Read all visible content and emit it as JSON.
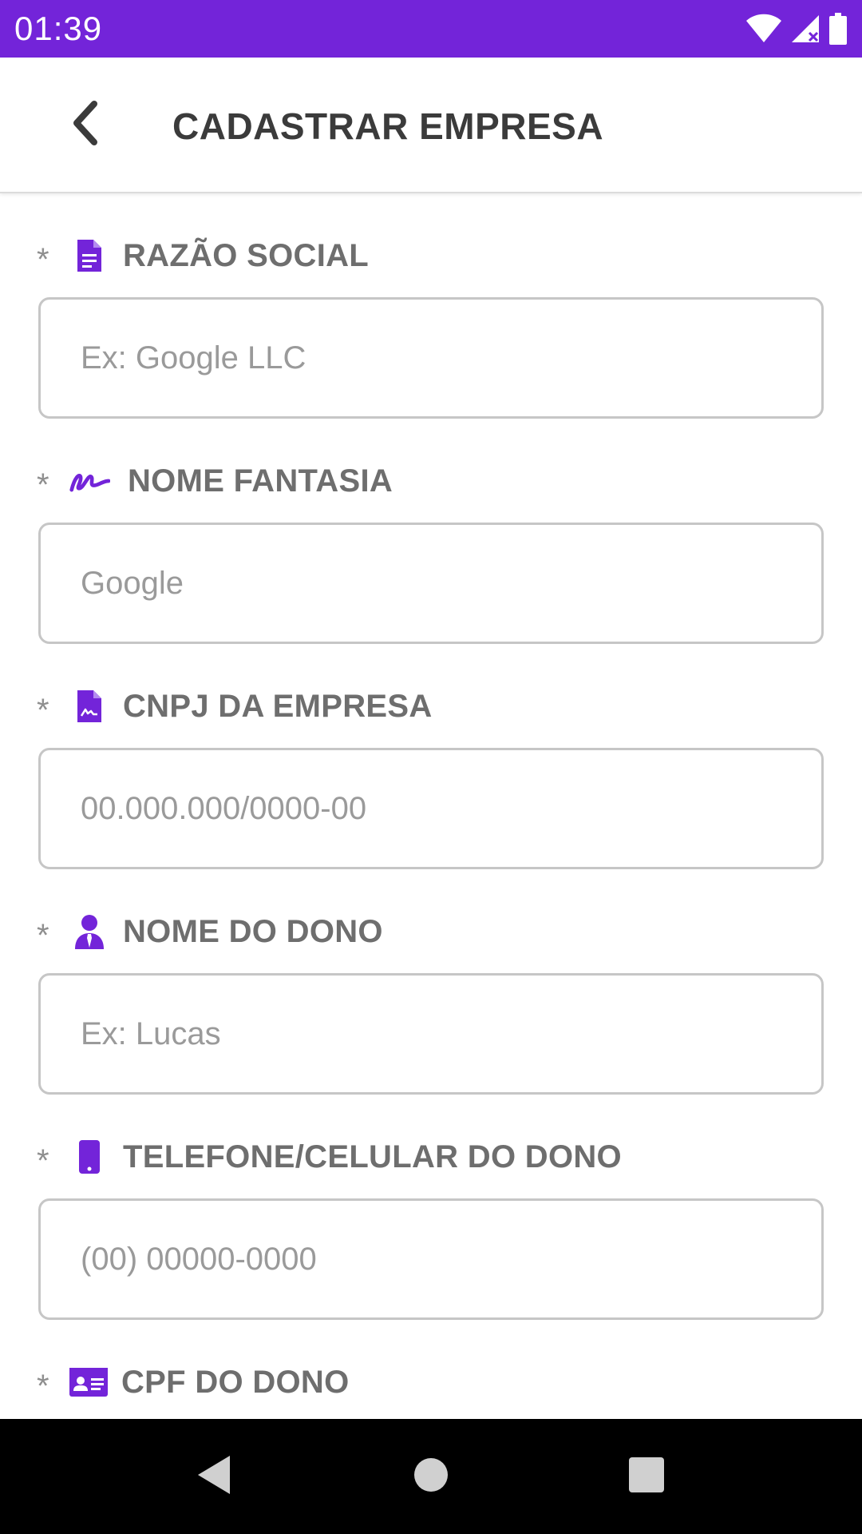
{
  "status_bar": {
    "time": "01:39",
    "icons": [
      "wifi-icon",
      "signal-icon",
      "battery-icon"
    ],
    "background_color": "#7324d9"
  },
  "app_bar": {
    "title": "CADASTRAR EMPRESA",
    "back_icon": "chevron-left-icon"
  },
  "form": {
    "accent_color": "#7324d9",
    "fields": [
      {
        "required": "*",
        "icon": "document-icon",
        "label": "RAZÃO SOCIAL",
        "placeholder": "Ex: Google LLC",
        "value": ""
      },
      {
        "required": "*",
        "icon": "signature-icon",
        "label": "NOME FANTASIA",
        "placeholder": "Google",
        "value": ""
      },
      {
        "required": "*",
        "icon": "file-contract-icon",
        "label": "CNPJ DA EMPRESA",
        "placeholder": "00.000.000/0000-00",
        "value": ""
      },
      {
        "required": "*",
        "icon": "user-tie-icon",
        "label": "NOME DO DONO",
        "placeholder": "Ex: Lucas",
        "value": ""
      },
      {
        "required": "*",
        "icon": "mobile-phone-icon",
        "label": "TELEFONE/CELULAR DO DONO",
        "placeholder": "(00) 00000-0000",
        "value": ""
      },
      {
        "required": "*",
        "icon": "id-card-icon",
        "label": "CPF DO DONO",
        "placeholder": "",
        "value": ""
      }
    ]
  },
  "nav_bar": {
    "buttons": [
      "back-triangle-icon",
      "home-circle-icon",
      "recents-square-icon"
    ]
  }
}
